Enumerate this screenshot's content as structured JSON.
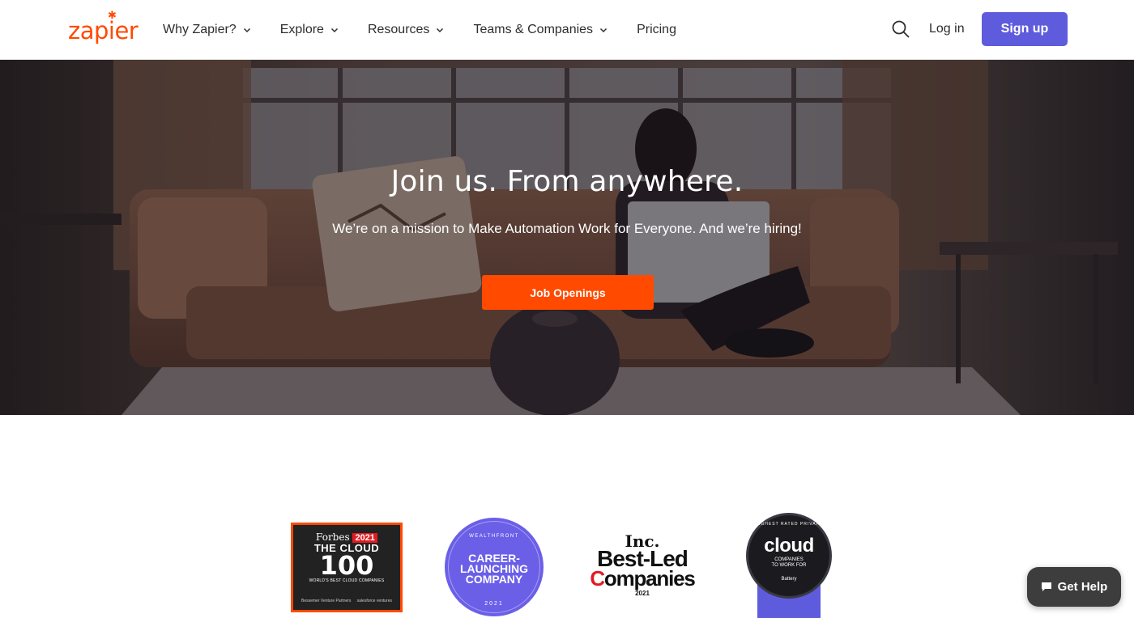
{
  "header": {
    "logo_text": "zapier",
    "nav": [
      {
        "label": "Why Zapier?",
        "has_dropdown": true
      },
      {
        "label": "Explore",
        "has_dropdown": true
      },
      {
        "label": "Resources",
        "has_dropdown": true
      },
      {
        "label": "Teams & Companies",
        "has_dropdown": true
      },
      {
        "label": "Pricing",
        "has_dropdown": false
      }
    ],
    "search_icon": "search-icon",
    "login_label": "Log in",
    "signup_label": "Sign up"
  },
  "hero": {
    "title": "Join us. From anywhere.",
    "subtitle": "We’re on a mission to Make Automation Work for Everyone. And we’re hiring!",
    "cta_label": "Job Openings"
  },
  "awards": {
    "forbes": {
      "brand": "Forbes",
      "year": "2021",
      "line1": "THE CLOUD",
      "line2": "100",
      "line3": "WORLD'S BEST CLOUD COMPANIES",
      "foot_left": "Bessemer Venture Partners",
      "foot_right": "salesforce ventures"
    },
    "career": {
      "top": "WEALTHFRONT",
      "line1": "CAREER-",
      "line2": "LAUNCHING",
      "line3": "COMPANY",
      "year": "2021"
    },
    "inc": {
      "brand": "Inc.",
      "line1": "Best-Led",
      "line2_pre": "C",
      "line2_post": "ompanies",
      "year": "2021"
    },
    "cloud_badge": {
      "top": "HIGHEST RATED PRIVATE",
      "word": "cloud",
      "line1": "COMPANIES",
      "line2": "TO WORK FOR",
      "sponsor": "Battery"
    }
  },
  "help": {
    "label": "Get Help",
    "icon": "chat-icon"
  },
  "colors": {
    "brand_orange": "#ff4a00",
    "signup_purple": "#5e5cdc"
  }
}
